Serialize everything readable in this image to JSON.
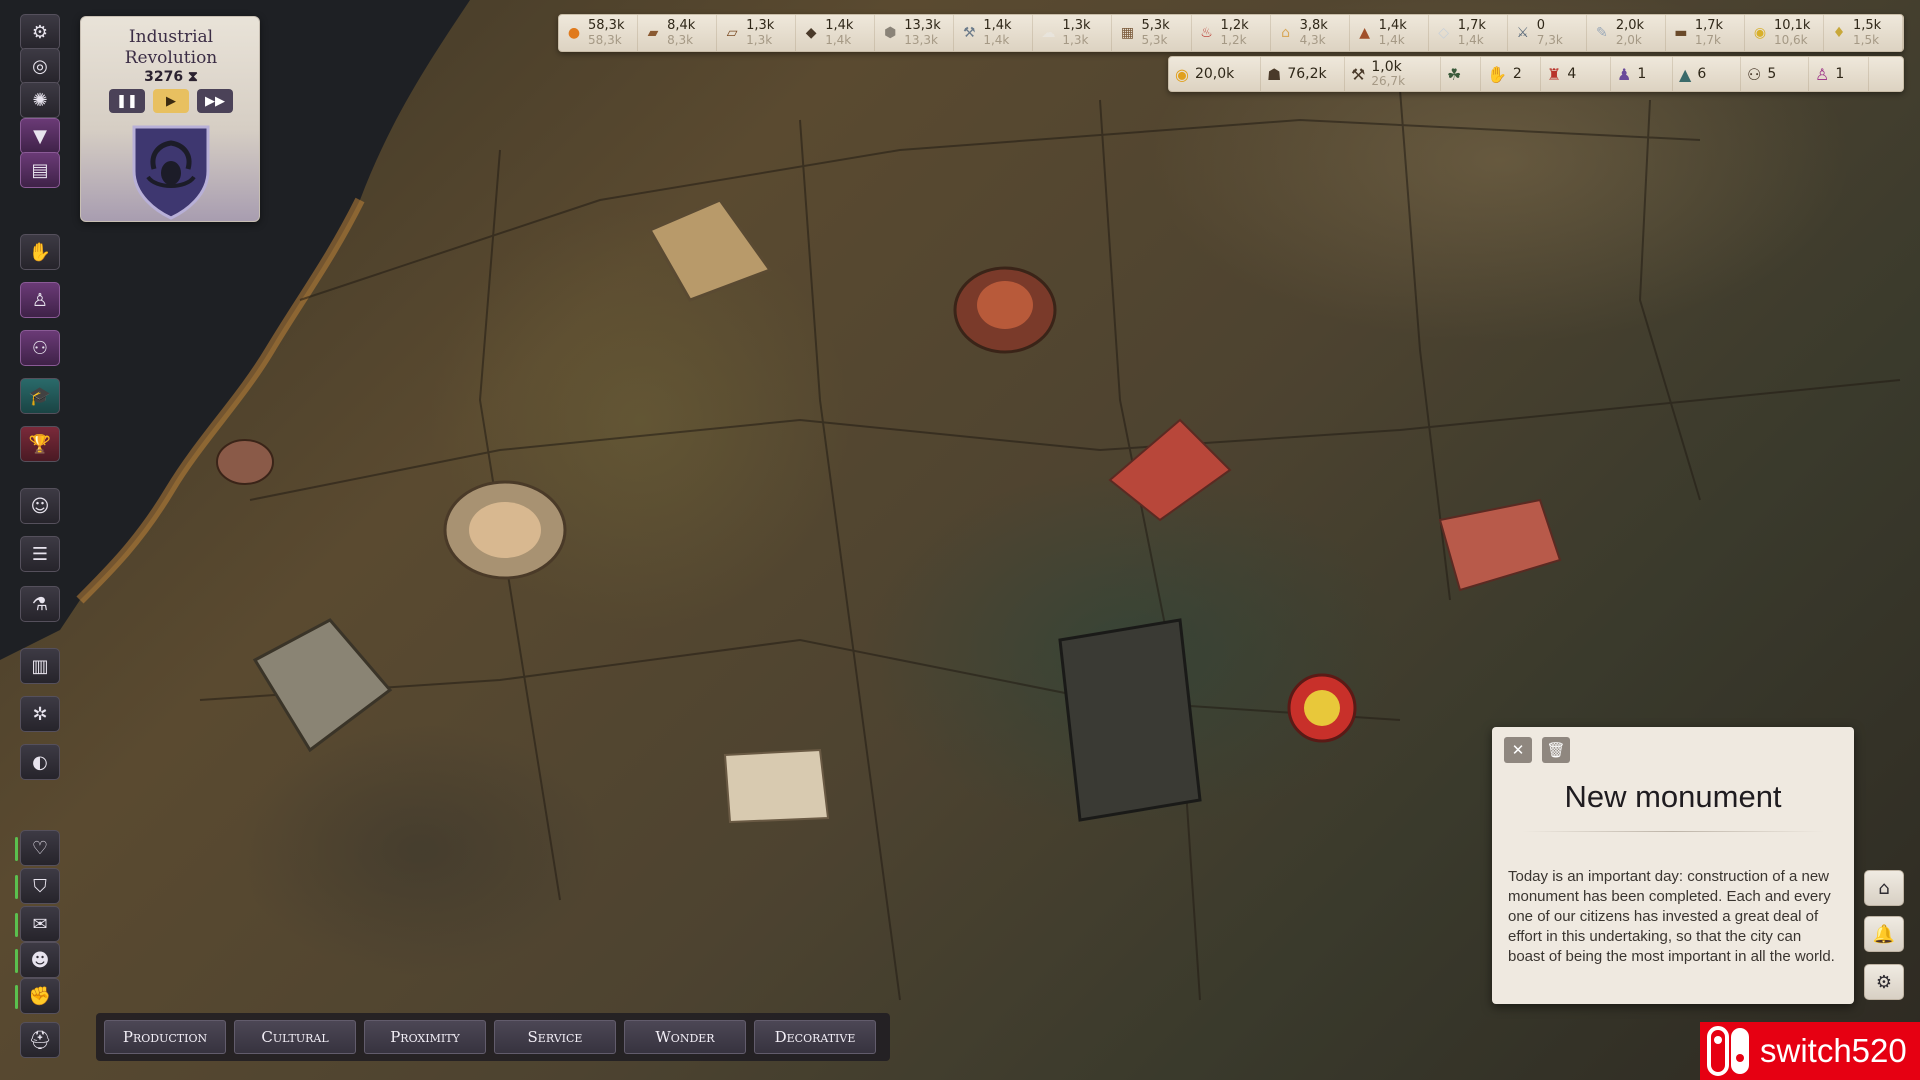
{
  "era": {
    "title": "Industrial Revolution",
    "year": "3276",
    "hourglass_icon": "hourglass-icon",
    "controls": {
      "pause": "pause-icon",
      "play": "play-icon",
      "fast": "fast-forward-icon"
    }
  },
  "left_toolbar": {
    "icons": [
      "gear-icon",
      "eye-off-icon",
      "sun-icon",
      "filter-icon",
      "book-icon",
      "hand-icon",
      "person-icon",
      "people-icon",
      "graduation-cap-icon",
      "trophy-icon",
      "group-icon",
      "list-icon",
      "potion-icon",
      "chart-icon",
      "settings-icon",
      "globe-icon",
      "health-icon",
      "shield-icon",
      "chat-icon",
      "citizen-icon",
      "fist-icon",
      "helmet-icon"
    ]
  },
  "resources": [
    {
      "icon": "food-icon",
      "color": "#e07a1c",
      "current": "58,3k",
      "capacity": "58,3k"
    },
    {
      "icon": "wood-icon",
      "color": "#8a5a32",
      "current": "8,4k",
      "capacity": "8,3k"
    },
    {
      "icon": "plank-icon",
      "color": "#7a4a22",
      "current": "1,3k",
      "capacity": "1,3k"
    },
    {
      "icon": "ore-icon",
      "color": "#4a3a2a",
      "current": "1,4k",
      "capacity": "1,4k"
    },
    {
      "icon": "stone-icon",
      "color": "#8a8378",
      "current": "13,3k",
      "capacity": "13,3k"
    },
    {
      "icon": "tool-icon",
      "color": "#6a7a8a",
      "current": "1,4k",
      "capacity": "1,4k"
    },
    {
      "icon": "cloth-icon",
      "color": "#e8e4dc",
      "current": "1,3k",
      "capacity": "1,3k"
    },
    {
      "icon": "brick-icon",
      "color": "#7a5a3a",
      "current": "5,3k",
      "capacity": "5,3k"
    },
    {
      "icon": "meat-icon",
      "color": "#b8322a",
      "current": "1,2k",
      "capacity": "1,2k"
    },
    {
      "icon": "grain-icon",
      "color": "#d8a85a",
      "current": "3,8k",
      "capacity": "4,3k"
    },
    {
      "icon": "leather-icon",
      "color": "#a0502a",
      "current": "1,4k",
      "capacity": "1,4k"
    },
    {
      "icon": "glass-icon",
      "color": "#c8d0d8",
      "current": "1,7k",
      "capacity": "1,4k"
    },
    {
      "icon": "iron-icon",
      "color": "#5a6a7a",
      "current": "0",
      "capacity": "7,3k"
    },
    {
      "icon": "paper-icon",
      "color": "#9aa8b8",
      "current": "2,0k",
      "capacity": "2,0k"
    },
    {
      "icon": "furniture-icon",
      "color": "#6a4a2a",
      "current": "1,7k",
      "capacity": "1,7k"
    },
    {
      "icon": "gold-icon",
      "color": "#d8b02a",
      "current": "10,1k",
      "capacity": "10,6k"
    },
    {
      "icon": "wine-icon",
      "color": "#c8a83a",
      "current": "1,5k",
      "capacity": "1,5k"
    }
  ],
  "stats": [
    {
      "icon": "coins-icon",
      "color": "#e0a01c",
      "value": "20,0k"
    },
    {
      "icon": "population-icon",
      "color": "#4a3a2a",
      "value": "76,2k"
    },
    {
      "icon": "workers-icon",
      "color": "#4a3a2a",
      "value": "1,0k",
      "sub": "26,7k"
    },
    {
      "icon": "family-icon",
      "color": "#3a5a3a",
      "value": ""
    },
    {
      "icon": "hand-icon",
      "color": "#3a6a3a",
      "value": "2"
    },
    {
      "icon": "trophy-icon",
      "color": "#b8322a",
      "value": "4"
    },
    {
      "icon": "figure-icon",
      "color": "#6a4a9a",
      "value": "1"
    },
    {
      "icon": "graduation-cap-icon",
      "color": "#3a6a6a",
      "value": "6"
    },
    {
      "icon": "people-icon",
      "color": "#4a3a2a",
      "value": "5"
    },
    {
      "icon": "person-icon",
      "color": "#a03a8a",
      "value": "1"
    }
  ],
  "notification": {
    "title": "New monument",
    "body": "Today is an important day: construction of a new monument has been completed. Each and every one of our citizens has invested a great deal of effort in this undertaking, so that the city can boast of being the most important in all the world.",
    "close_icon": "close-icon",
    "delete_icon": "trash-icon"
  },
  "right_buttons": [
    "monument-icon",
    "bell-icon",
    "settings-icon"
  ],
  "categories": [
    "Production",
    "Cultural",
    "Proximity",
    "Service",
    "Wonder",
    "Decorative"
  ],
  "watermark": {
    "text": "switch520",
    "logo": "switch-logo-icon"
  }
}
